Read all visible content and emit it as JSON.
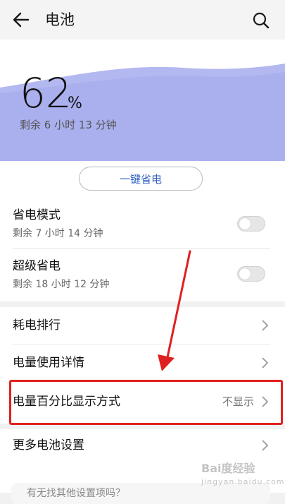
{
  "header": {
    "title": "电池"
  },
  "battery": {
    "percent": "62",
    "percent_sign": "%",
    "remaining": "剩余 6 小时 13 分钟"
  },
  "one_key_save": {
    "label": "一键省电"
  },
  "power_save_mode": {
    "title": "省电模式",
    "subtitle": "剩余 7 小时 14 分钟",
    "enabled": false
  },
  "ultra_power_save": {
    "title": "超级省电",
    "subtitle": "剩余 18 小时 12 分钟",
    "enabled": false
  },
  "menu": {
    "consumption_ranking": "耗电排行",
    "usage_details": "电量使用详情",
    "percent_display": {
      "label": "电量百分比显示方式",
      "value": "不显示"
    },
    "more_settings": "更多电池设置"
  },
  "hint": {
    "text": "有无找其他设置项吗？"
  },
  "watermark": {
    "text": "Bai度经验",
    "sub": "jingyan.baidu.com"
  },
  "colors": {
    "wave": "#b3b8f0",
    "accent": "#2f5fbe",
    "highlight": "#e02020"
  }
}
